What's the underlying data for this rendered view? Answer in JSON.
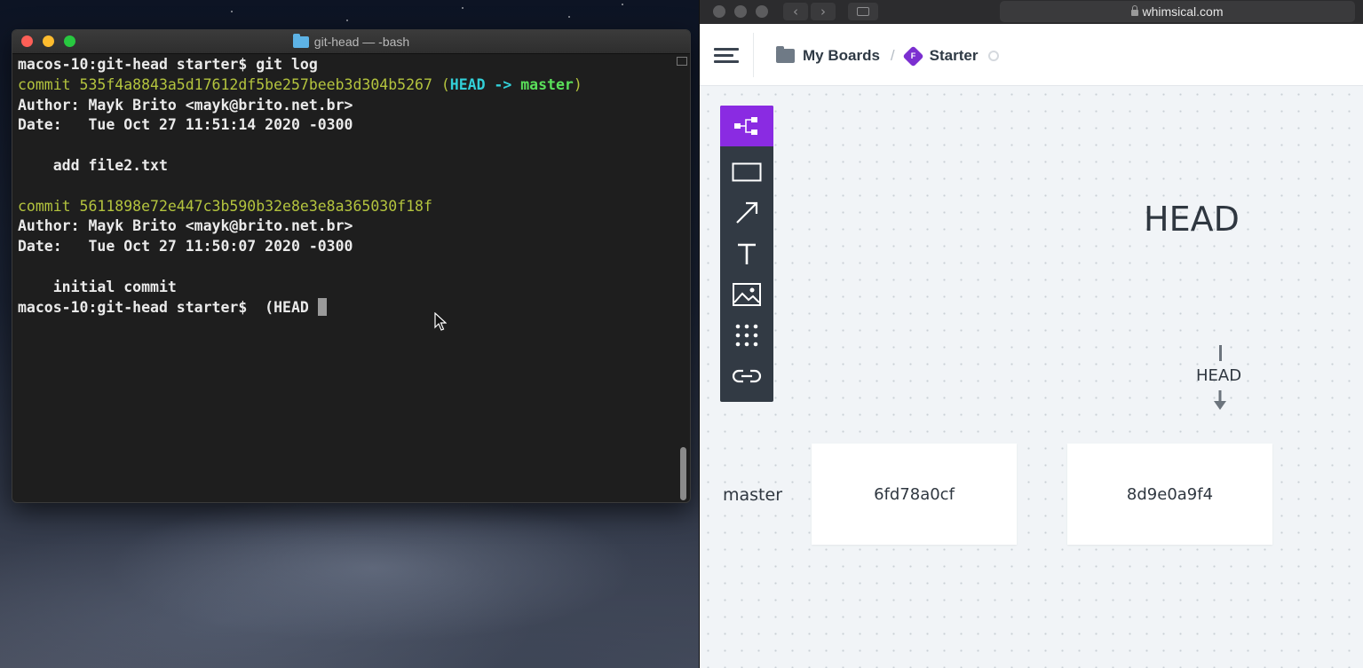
{
  "terminal": {
    "title": "git-head — -bash",
    "lines": [
      {
        "segments": [
          {
            "text": "macos-10:git-head starter$ git log",
            "cls": ""
          }
        ]
      },
      {
        "segments": [
          {
            "text": "commit 535f4a8843a5d17612df5be257beeb3d304b5267 ",
            "cls": "c-yellow"
          },
          {
            "text": "(",
            "cls": "c-yellow"
          },
          {
            "text": "HEAD -> ",
            "cls": "c-cyan"
          },
          {
            "text": "master",
            "cls": "c-green"
          },
          {
            "text": ")",
            "cls": "c-yellow"
          }
        ]
      },
      {
        "segments": [
          {
            "text": "Author: Mayk Brito <mayk@brito.net.br>",
            "cls": ""
          }
        ]
      },
      {
        "segments": [
          {
            "text": "Date:   Tue Oct 27 11:51:14 2020 -0300",
            "cls": ""
          }
        ]
      },
      {
        "segments": [
          {
            "text": "",
            "cls": ""
          }
        ]
      },
      {
        "segments": [
          {
            "text": "    add file2.txt",
            "cls": ""
          }
        ]
      },
      {
        "segments": [
          {
            "text": "",
            "cls": ""
          }
        ]
      },
      {
        "segments": [
          {
            "text": "commit 5611898e72e447c3b590b32e8e3e8a365030f18f",
            "cls": "c-yellow"
          }
        ]
      },
      {
        "segments": [
          {
            "text": "Author: Mayk Brito <mayk@brito.net.br>",
            "cls": ""
          }
        ]
      },
      {
        "segments": [
          {
            "text": "Date:   Tue Oct 27 11:50:07 2020 -0300",
            "cls": ""
          }
        ]
      },
      {
        "segments": [
          {
            "text": "",
            "cls": ""
          }
        ]
      },
      {
        "segments": [
          {
            "text": "    initial commit",
            "cls": ""
          }
        ]
      }
    ],
    "prompt": "macos-10:git-head starter$  (HEAD "
  },
  "browser": {
    "url": "whimsical.com"
  },
  "whimsical": {
    "breadcrumb": {
      "boards_label": "My Boards",
      "separator": "/",
      "board_badge": "F",
      "board_name": "Starter"
    },
    "canvas": {
      "head_title": "HEAD",
      "head_pointer_label": "HEAD",
      "branch_label": "master",
      "commits": [
        "6fd78a0cf",
        "8d9e0a9f4"
      ]
    }
  }
}
